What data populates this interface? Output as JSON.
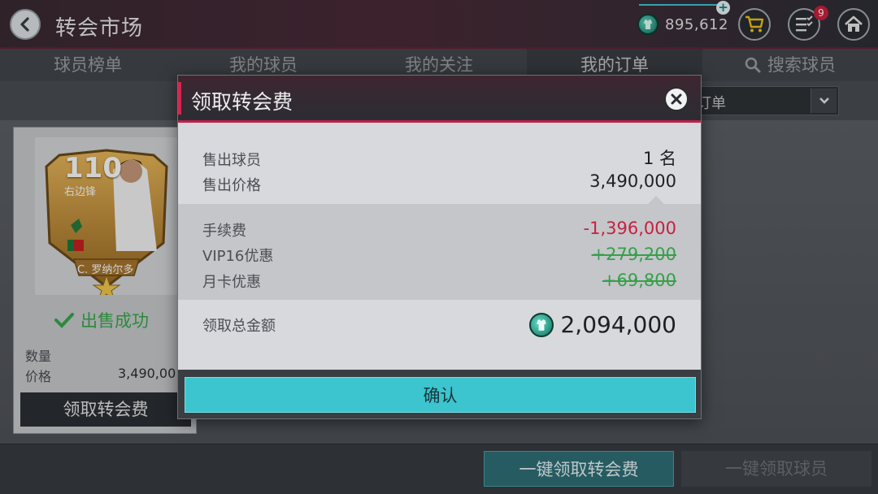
{
  "header": {
    "title": "转会市场",
    "coins": "895,612",
    "notification_count": "9"
  },
  "tabs": [
    {
      "label": "球员榜单"
    },
    {
      "label": "我的球员"
    },
    {
      "label": "我的关注"
    },
    {
      "label": "我的订单"
    },
    {
      "label": "搜索球员"
    }
  ],
  "filter": {
    "selected": "订单"
  },
  "player": {
    "rating": "110",
    "position": "右边锋",
    "name": "C. 罗纳尔多",
    "status": "出售成功",
    "qty_label": "数量",
    "qty_value": "",
    "price_label": "价格",
    "price_value": "3,490,00",
    "claim_label": "领取转会费"
  },
  "modal": {
    "title": "领取转会费",
    "sold_players_label": "售出球员",
    "sold_players_value": "1 名",
    "sold_price_label": "售出价格",
    "sold_price_value": "3,490,000",
    "fee_label": "手续费",
    "fee_value": "-1,396,000",
    "vip_label": "VIP16优惠",
    "vip_value": "+279,200",
    "monthly_label": "月卡优惠",
    "monthly_value": "+69,800",
    "total_label": "领取总金额",
    "total_value": "2,094,000",
    "confirm_label": "确认"
  },
  "footer": {
    "claim_all_label": "一键领取转会费",
    "claim_players_label": "一键领取球员"
  },
  "colors": {
    "accent_red": "#c01f4a",
    "confirm_teal": "#3cc4cf",
    "fee_red": "#c8203f",
    "discount_green": "#36a04a",
    "success_green": "#37a84b"
  }
}
